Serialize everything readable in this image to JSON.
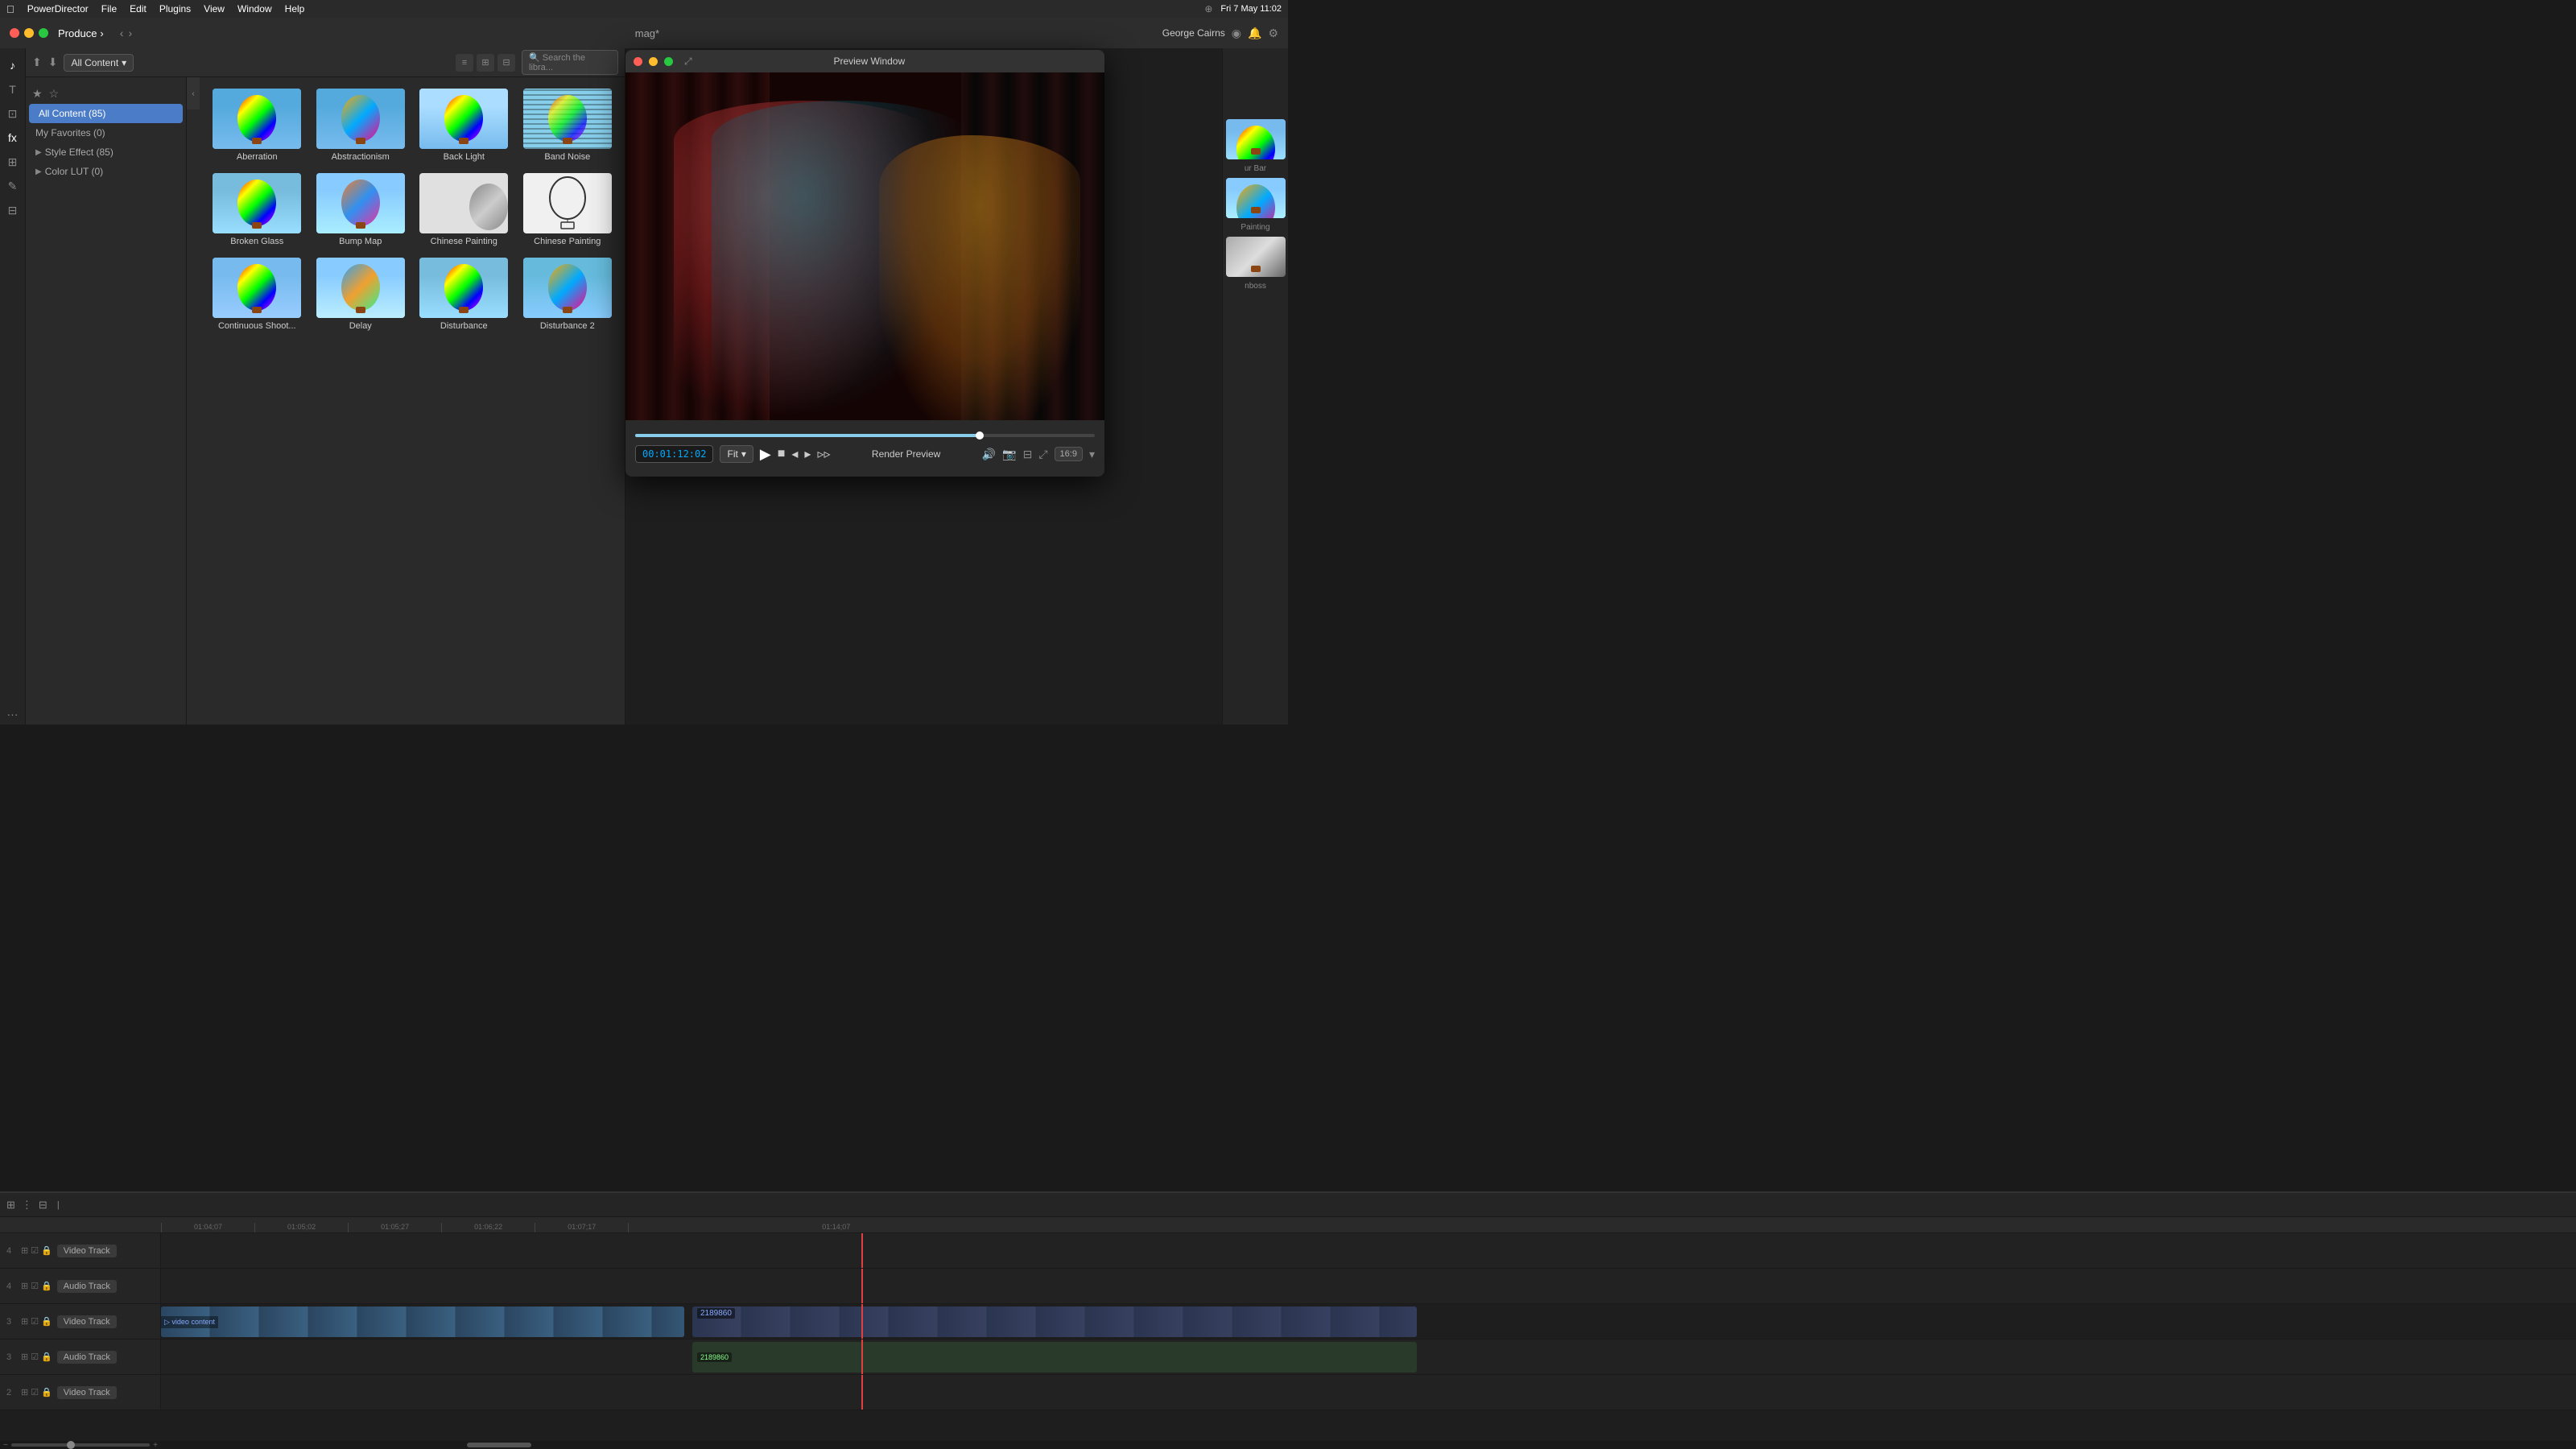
{
  "menubar": {
    "apple": "⌘",
    "app": "PowerDirector",
    "menus": [
      "File",
      "Edit",
      "Plugins",
      "View",
      "Window",
      "Help"
    ],
    "time": "Fri 7 May  11:02"
  },
  "titlebar": {
    "title": "mag*",
    "produce_label": "Produce",
    "user": "George Cairns"
  },
  "content": {
    "dropdown_label": "All Content",
    "filter": {
      "all_content": "All Content (85)",
      "my_favorites": "My Favorites (0)",
      "style_effect": "Style Effect (85)",
      "color_lut": "Color LUT (0)"
    },
    "effects": [
      {
        "name": "Aberration",
        "type": "colorful"
      },
      {
        "name": "Abstractionism",
        "type": "colorful"
      },
      {
        "name": "Back Light",
        "type": "colorful"
      },
      {
        "name": "Band Noise",
        "type": "noise"
      },
      {
        "name": "Broken Glass",
        "type": "colorful"
      },
      {
        "name": "Bump Map",
        "type": "colorful"
      },
      {
        "name": "Chinese Painting",
        "type": "gray"
      },
      {
        "name": "Chinese Painting",
        "type": "outline"
      },
      {
        "name": "Continuous Shoot...",
        "type": "colorful"
      },
      {
        "name": "Delay",
        "type": "colorful"
      },
      {
        "name": "Disturbance",
        "type": "colorful"
      },
      {
        "name": "Disturbance 2",
        "type": "colorful"
      }
    ]
  },
  "preview": {
    "title": "Preview Window",
    "timecode": "00:01:12:02",
    "fit_label": "Fit",
    "render_preview": "Render Preview",
    "aspect_ratio": "16:9"
  },
  "far_right": {
    "items": [
      {
        "label": "ur Bar"
      },
      {
        "label": "Painting"
      },
      {
        "label": "nboss"
      }
    ]
  },
  "timeline": {
    "tracks": [
      {
        "num": "4",
        "type": "video",
        "name": "Video Track"
      },
      {
        "num": "4",
        "type": "audio",
        "name": "Audio Track"
      },
      {
        "num": "3",
        "type": "video",
        "name": "Video Track"
      },
      {
        "num": "3",
        "type": "audio",
        "name": "Audio Track"
      },
      {
        "num": "2",
        "type": "video",
        "name": "Video Track"
      }
    ],
    "clip_labels": [
      "2189860",
      "2189860"
    ],
    "timecodes": [
      "01:04;07",
      "01:05;02",
      "01:05;27",
      "01:06;22",
      "01:07;17",
      "01:14;07"
    ]
  }
}
